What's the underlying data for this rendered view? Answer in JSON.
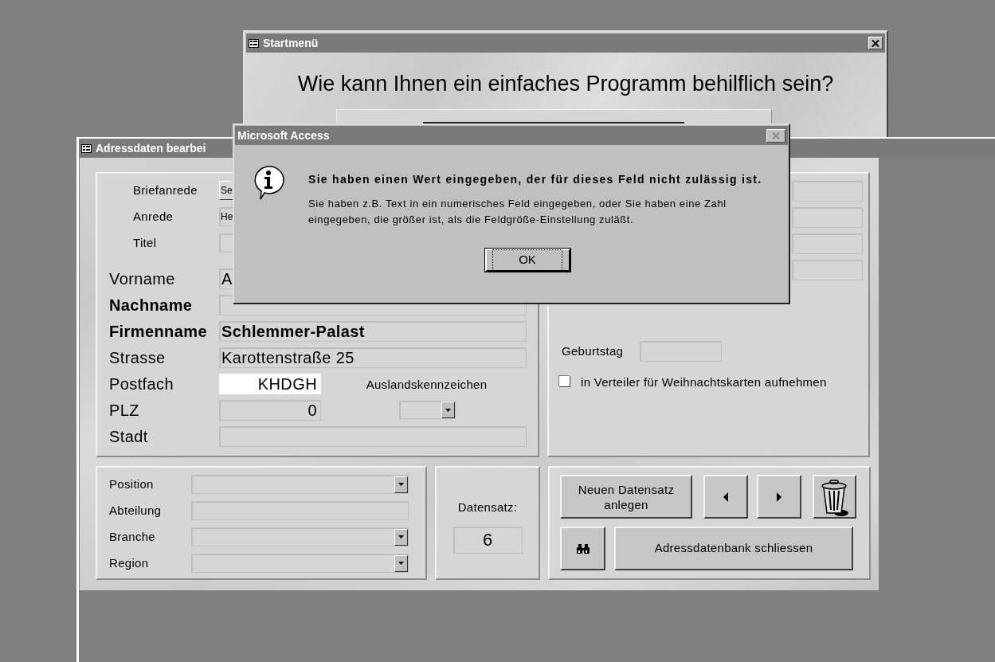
{
  "startmenu": {
    "title": "Startmenü",
    "question": "Wie kann Ihnen ein einfaches Programm behilflich sein?",
    "close_disabled": false
  },
  "address_window": {
    "title": "Adressdaten bearbei",
    "salutation_fields": [
      {
        "label": "Briefanrede",
        "value": "Se",
        "kind": "combo"
      },
      {
        "label": "Anrede",
        "value": "He",
        "kind": "text"
      },
      {
        "label": "Titel",
        "kind": "text"
      }
    ],
    "name_fields": [
      {
        "label": "Vorname",
        "value": "A",
        "kind": "text",
        "bold": false,
        "focused": false
      },
      {
        "label": "Nachname",
        "kind": "text",
        "bold": true,
        "focused": false
      },
      {
        "label": "Firmenname",
        "value": "Schlemmer-Palast",
        "kind": "text",
        "bold": true,
        "focused": false
      },
      {
        "label": "Strasse",
        "value": "Karottenstraße 25",
        "kind": "text",
        "bold": false,
        "focused": false
      },
      {
        "label": "Postfach",
        "value": "KHDGH",
        "kind": "number",
        "bold": false,
        "focused": true,
        "aside": {
          "kind": "label",
          "text": "Auslandskennzeichen"
        }
      },
      {
        "label": "PLZ",
        "value": "0",
        "kind": "number",
        "bold": false,
        "focused": false,
        "aside": {
          "kind": "combo"
        }
      },
      {
        "label": "Stadt",
        "kind": "text",
        "bold": false,
        "focused": false
      }
    ],
    "birthday": {
      "label": "Geburtstag"
    },
    "christmas_list": {
      "label": "in Verteiler für Weihnachtskarten aufnehmen",
      "checked": false
    },
    "job_fields": [
      {
        "label": "Position",
        "kind": "combo"
      },
      {
        "label": "Abteilung",
        "kind": "text"
      },
      {
        "label": "Branche",
        "kind": "combo"
      },
      {
        "label": "Region",
        "kind": "combo"
      }
    ],
    "record": {
      "label": "Datensatz:",
      "value": "6"
    },
    "buttons": {
      "new_record": "Neuen Datensatz anlegen",
      "close": "Adressdatenbank schliessen"
    }
  },
  "dialog": {
    "title": "Microsoft Access",
    "heading": "Sie haben einen Wert eingegeben, der für dieses Feld nicht zulässig ist.",
    "message": "Sie haben z.B. Text in ein numerisches Feld eingegeben, oder Sie haben eine Zahl eingegeben, die größer ist, als die Feldgröße-Einstellung zuläßt.",
    "ok": "OK",
    "close_disabled": true
  }
}
